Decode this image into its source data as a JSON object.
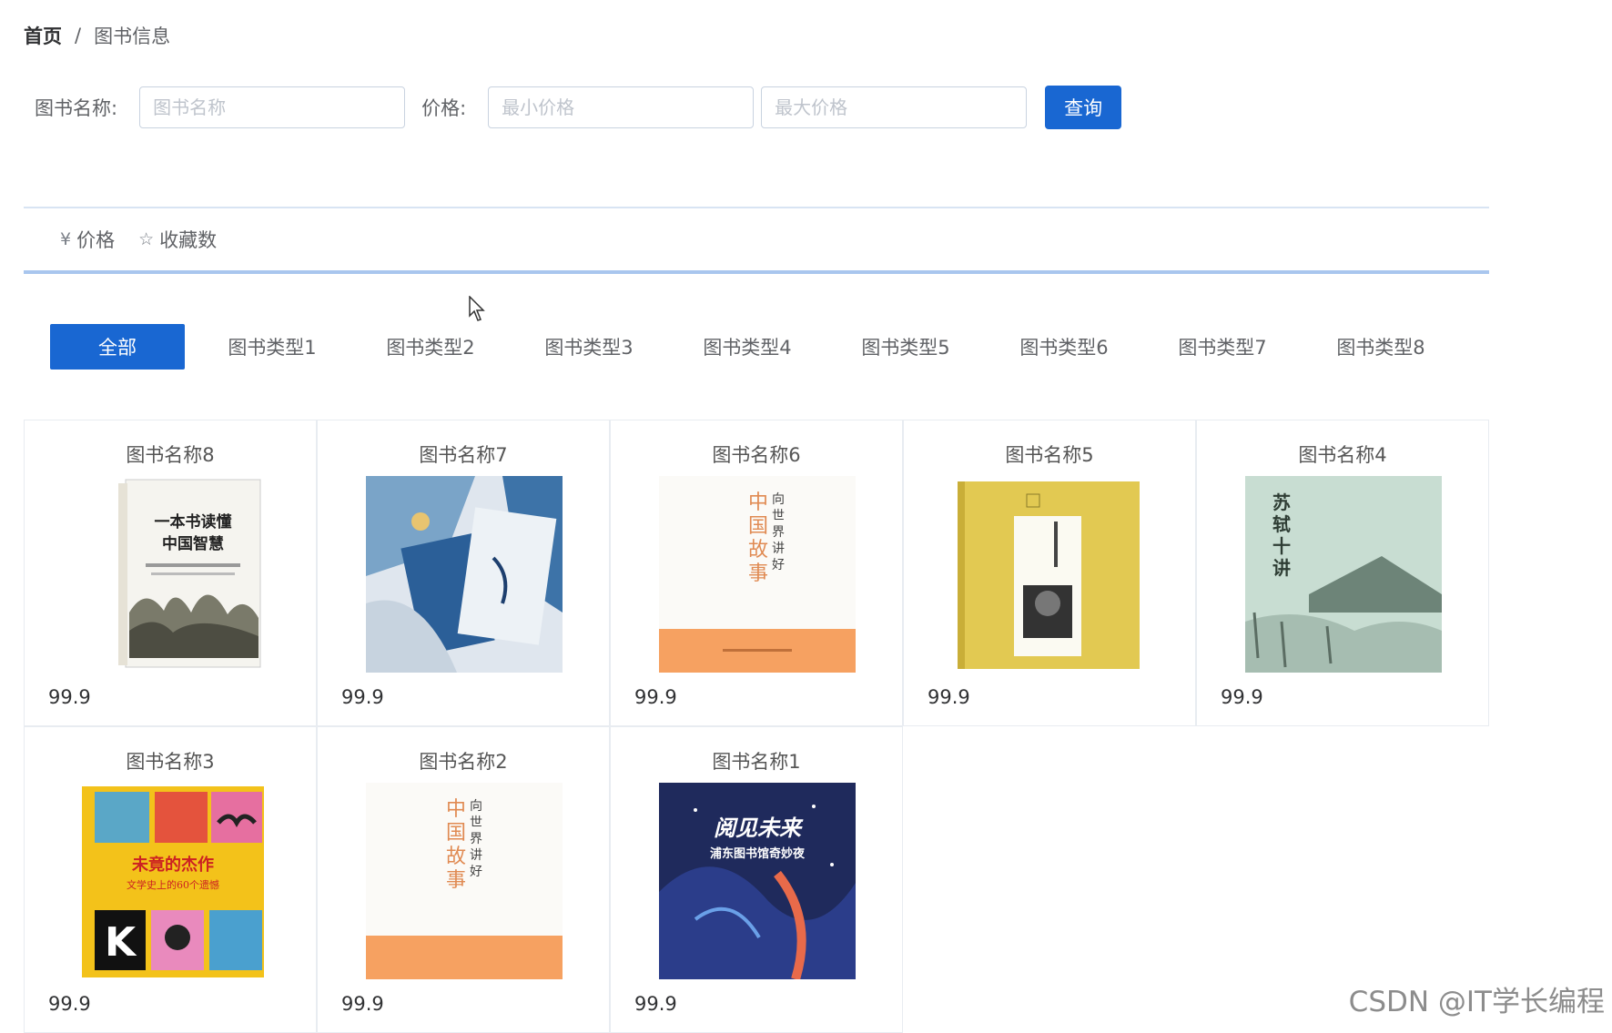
{
  "breadcrumb": {
    "home": "首页",
    "separator": "/",
    "current": "图书信息"
  },
  "search": {
    "name_label": "图书名称:",
    "name_placeholder": "图书名称",
    "price_label": "价格:",
    "min_placeholder": "最小价格",
    "max_placeholder": "最大价格",
    "query_button": "查询"
  },
  "sort": [
    {
      "label": "价格",
      "icon": "yen-icon",
      "glyph": "¥"
    },
    {
      "label": "收藏数",
      "icon": "star-icon",
      "glyph": "☆"
    }
  ],
  "categories": {
    "active": "全部",
    "items": [
      "图书类型1",
      "图书类型2",
      "图书类型3",
      "图书类型4",
      "图书类型5",
      "图书类型6",
      "图书类型7",
      "图书类型8"
    ]
  },
  "books": [
    {
      "name": "图书名称8",
      "price": "99.9",
      "cover": "classic-landscape",
      "cover_title": "一本书读懂 中国智慧"
    },
    {
      "name": "图书名称7",
      "price": "99.9",
      "cover": "blue-collage",
      "cover_title": ""
    },
    {
      "name": "图书名称6",
      "price": "99.9",
      "cover": "white-orange",
      "cover_title": "中国故事 向世界讲好"
    },
    {
      "name": "图书名称5",
      "price": "99.9",
      "cover": "yellow-portrait",
      "cover_title": ""
    },
    {
      "name": "图书名称4",
      "price": "99.9",
      "cover": "green-mountain",
      "cover_title": "苏轼十讲"
    },
    {
      "name": "图书名称3",
      "price": "99.9",
      "cover": "pop-collage",
      "cover_title": "未竟的杰作 文学史上的60个遗憾"
    },
    {
      "name": "图书名称2",
      "price": "99.9",
      "cover": "white-orange",
      "cover_title": "中国故事 向世界讲好"
    },
    {
      "name": "图书名称1",
      "price": "99.9",
      "cover": "night-galaxy",
      "cover_title": "阅见未来 浦东图书馆奇妙夜"
    }
  ],
  "colors": {
    "primary": "#1967d2",
    "border": "#e8ecf1",
    "accent_line": "#a9c6ee"
  },
  "watermark": "CSDN @IT学长编程"
}
